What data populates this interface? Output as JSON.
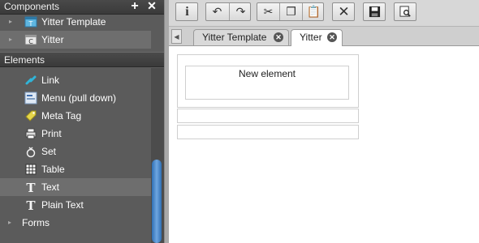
{
  "sidebar": {
    "components_header": "Components",
    "components": [
      {
        "label": "Yitter Template",
        "icon": "template-icon"
      },
      {
        "label": "Yitter",
        "icon": "component-icon"
      }
    ],
    "elements_header": "Elements",
    "elements": [
      {
        "label": "Link",
        "icon": "link-icon"
      },
      {
        "label": "Menu (pull down)",
        "icon": "menu-icon"
      },
      {
        "label": "Meta Tag",
        "icon": "tag-icon"
      },
      {
        "label": "Print",
        "icon": "print-icon"
      },
      {
        "label": "Set",
        "icon": "set-icon"
      },
      {
        "label": "Table",
        "icon": "table-icon"
      },
      {
        "label": "Text",
        "icon": "text-icon"
      },
      {
        "label": "Plain Text",
        "icon": "plain-text-icon"
      },
      {
        "label": "Forms",
        "icon": "folder-icon"
      }
    ],
    "selected_element": "Text"
  },
  "tabs": [
    {
      "label": "Yitter Template"
    },
    {
      "label": "Yitter",
      "active": true
    }
  ],
  "editor": {
    "element_label": "New element"
  },
  "colors": {
    "panel_bg": "#5b5b5b",
    "selected_row": "#6e6e6e",
    "scroll_thumb": "#3f84cc"
  }
}
